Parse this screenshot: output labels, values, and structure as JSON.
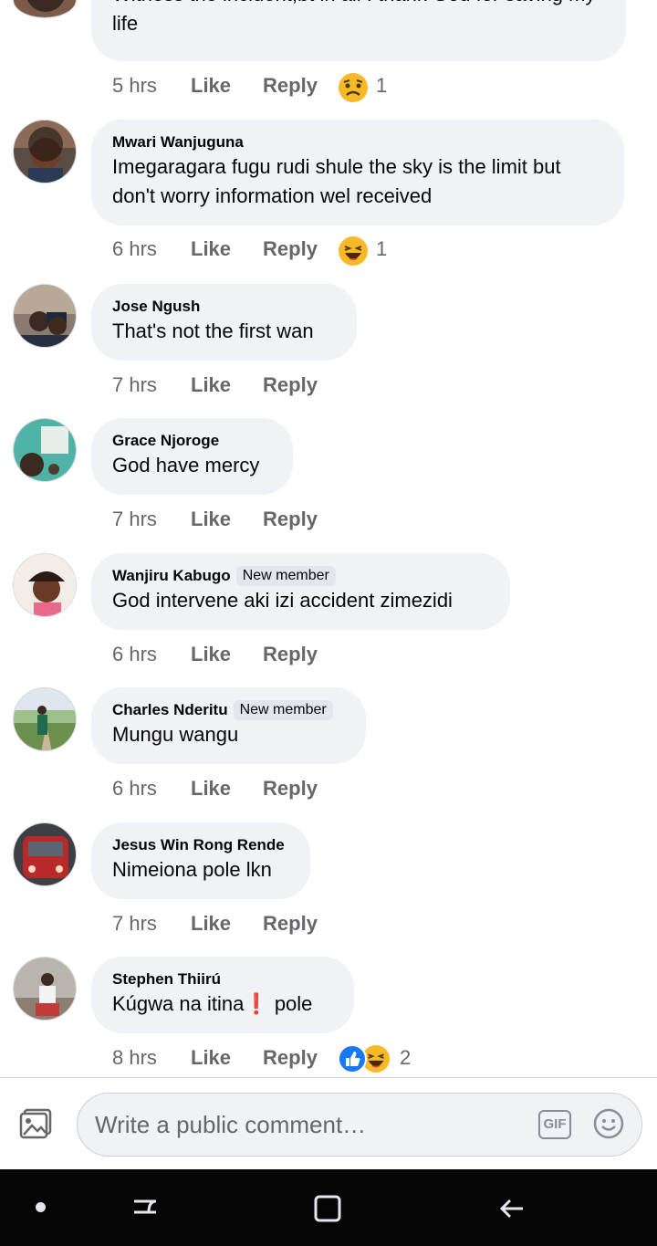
{
  "comments": [
    {
      "text": "Witness the incident,bt in all I thank God for saving my life",
      "time": "5 hrs",
      "reaction_count": "1"
    },
    {
      "author": "Mwari Wanjuguna",
      "text": "Imegaragara fugu rudi shule the sky is the limit but don't worry information wel received",
      "time": "6 hrs",
      "reaction_count": "1"
    },
    {
      "author": "Jose Ngush",
      "text": "That's not the first wan",
      "time": "7 hrs"
    },
    {
      "author": "Grace Njoroge",
      "text": "God have mercy",
      "time": "7 hrs"
    },
    {
      "author": "Wanjiru Kabugo",
      "badge": "New member",
      "text": "God intervene aki izi accident zimezidi",
      "time": "6 hrs"
    },
    {
      "author": "Charles Nderitu",
      "badge": "New member",
      "text": "Mungu wangu",
      "time": "6 hrs"
    },
    {
      "author": "Jesus Win Rong Rende",
      "text": "Nimeiona pole lkn",
      "time": "7 hrs"
    },
    {
      "author": "Stephen Thiirú",
      "text": "Kúgwa na itina❗ pole",
      "time": "8 hrs",
      "reaction_count": "2"
    }
  ],
  "actions": {
    "like": "Like",
    "reply": "Reply"
  },
  "composer": {
    "placeholder": "Write a public comment…",
    "gif_label": "GIF"
  },
  "colors": {
    "bubble": "#f0f2f5",
    "meta": "#65676b",
    "like_blue": "#1877f2",
    "haha_yellow": "#f7b928"
  },
  "icons": [
    "photo-icon",
    "gif-icon",
    "smiley-icon",
    "sad-reaction-icon",
    "haha-reaction-icon",
    "like-reaction-icon",
    "recent-apps-icon",
    "home-icon",
    "back-icon"
  ]
}
